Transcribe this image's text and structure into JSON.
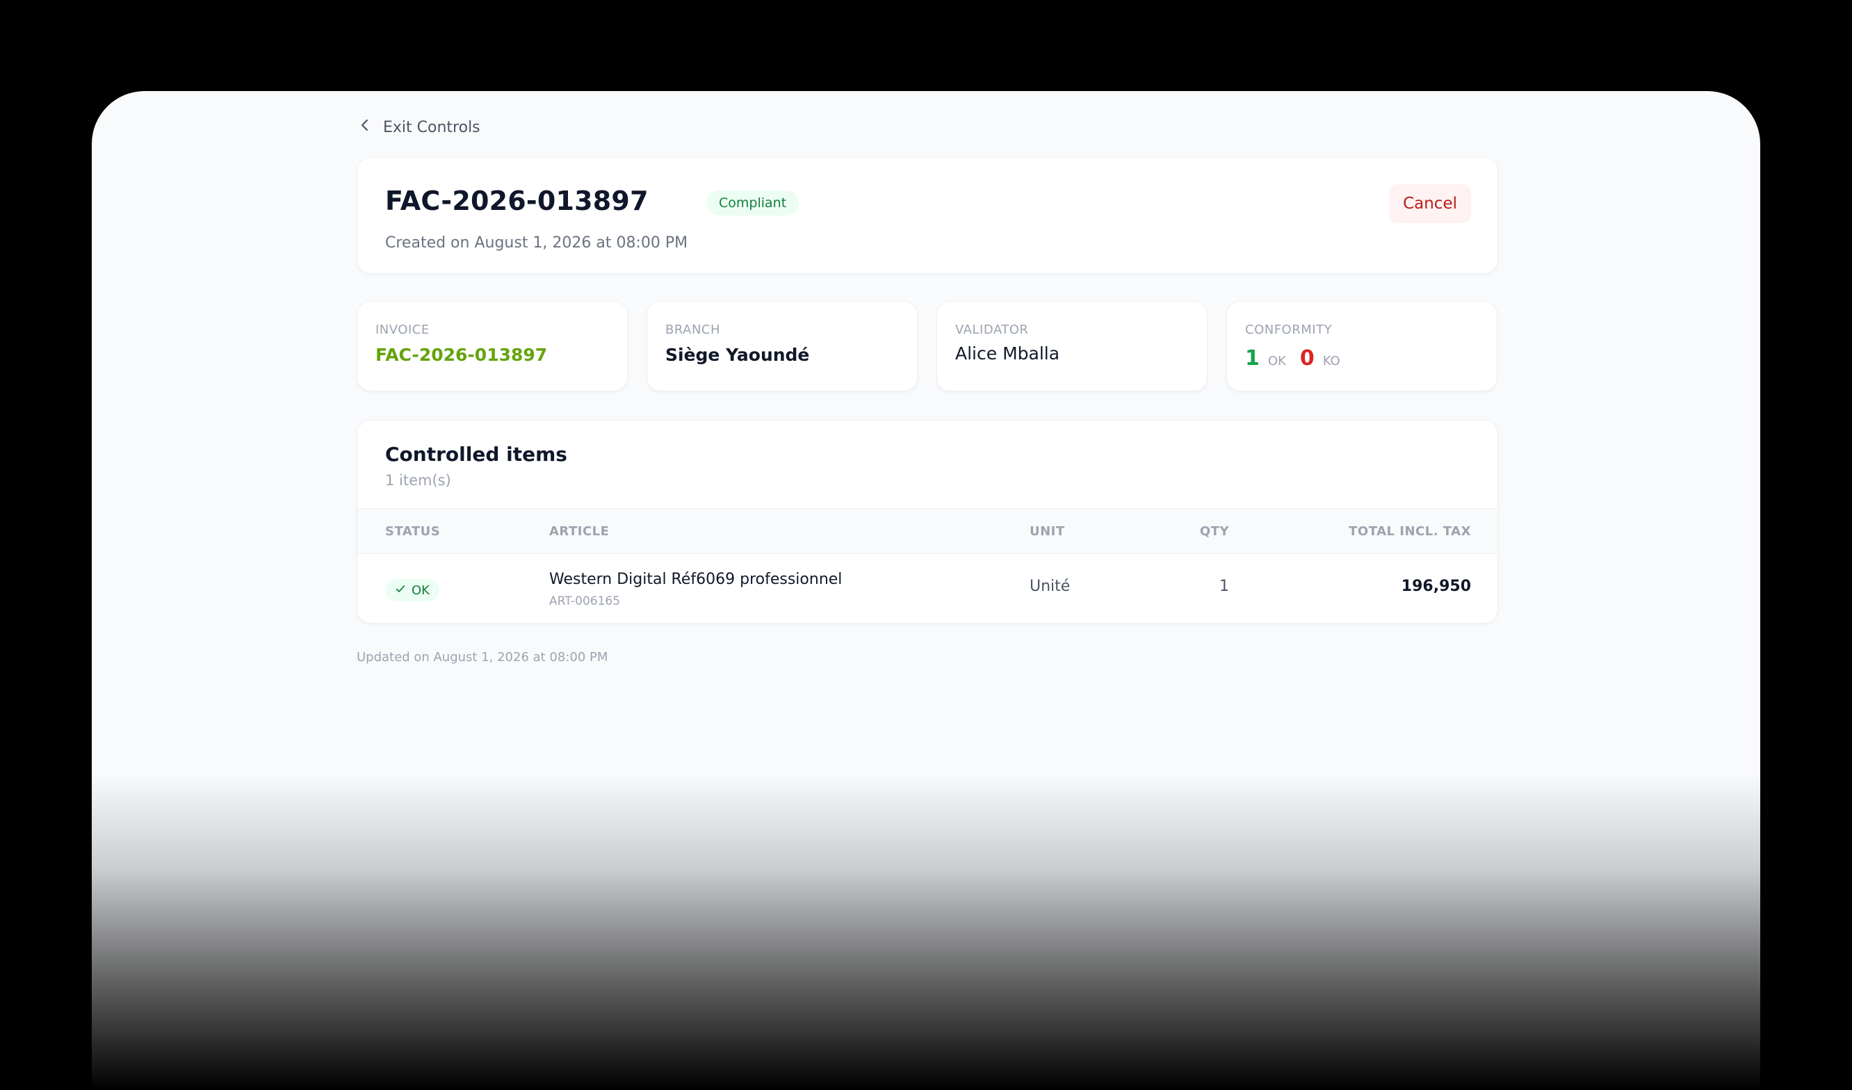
{
  "nav": {
    "back_label": "Exit Controls"
  },
  "header": {
    "title": "FAC-2026-013897",
    "status_badge": "Compliant",
    "created": "Created on August 1, 2026 at 08:00 PM",
    "cancel_label": "Cancel"
  },
  "stats": {
    "invoice": {
      "label": "INVOICE",
      "value": "FAC-2026-013897"
    },
    "branch": {
      "label": "BRANCH",
      "value": "Siège Yaoundé"
    },
    "validator": {
      "label": "VALIDATOR",
      "value": "Alice Mballa"
    },
    "conformity": {
      "label": "CONFORMITY",
      "ok_count": "1",
      "ok_label": "OK",
      "ko_count": "0",
      "ko_label": "KO"
    }
  },
  "items": {
    "title": "Controlled items",
    "count": "1 item(s)",
    "columns": {
      "status": "STATUS",
      "article": "ARTICLE",
      "unit": "UNIT",
      "qty": "QTY",
      "total": "TOTAL INCL. TAX"
    },
    "rows": [
      {
        "status": "OK",
        "article_name": "Western Digital Réf6069 professionnel",
        "article_code": "ART-006165",
        "unit": "Unité",
        "qty": "1",
        "total": "196,950"
      }
    ]
  },
  "footer": {
    "updated": "Updated on August 1, 2026 at 08:00 PM"
  },
  "colors": {
    "accent_link": "#65a30d",
    "ok_green": "#16a34a",
    "ko_red": "#dc2626",
    "cancel_text": "#b91c1c"
  },
  "icons": {
    "back": "chevron-left-icon",
    "status_ok": "check-icon"
  }
}
